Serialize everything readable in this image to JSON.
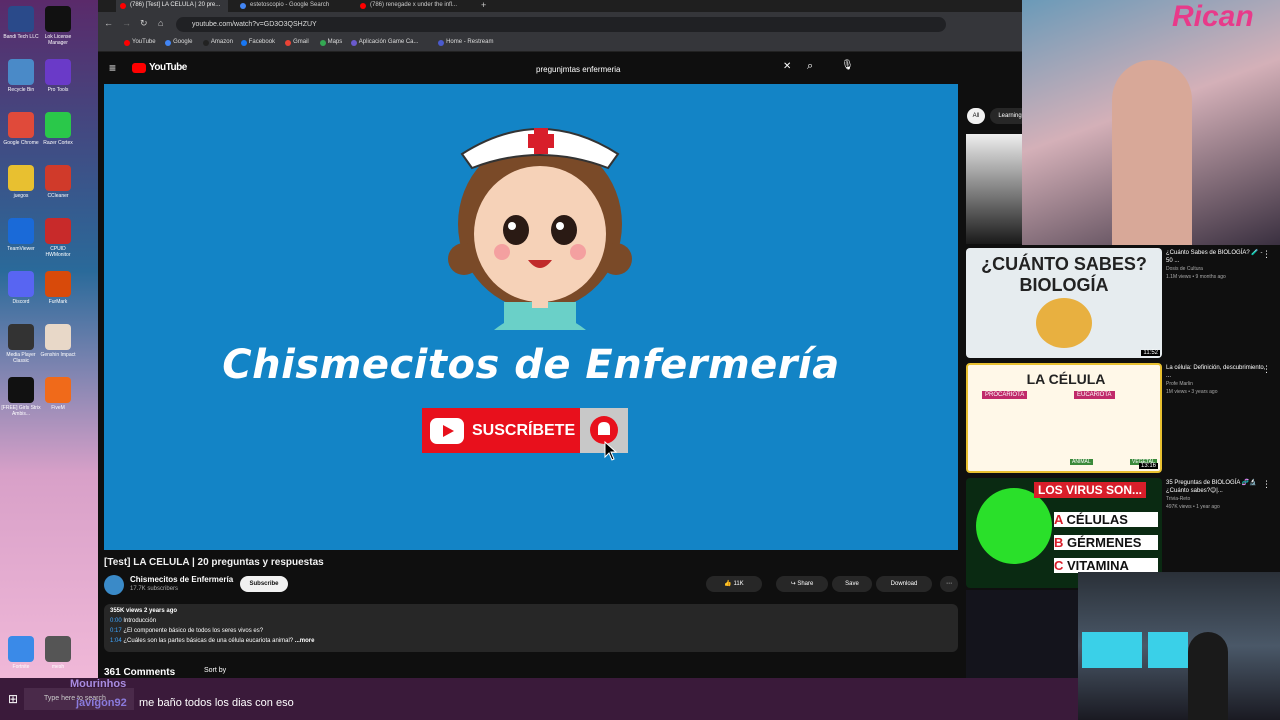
{
  "desktop": {
    "icons": [
      {
        "label": "Bandi Tech LLC",
        "color": "#2a4a8a"
      },
      {
        "label": "Lok License Manager",
        "color": "#111"
      },
      {
        "label": "Recycle Bin",
        "color": "#4a8ac8"
      },
      {
        "label": "Pro Tools",
        "color": "#6a3ac8"
      },
      {
        "label": "Google Chrome",
        "color": "#e04a3a"
      },
      {
        "label": "Razer Cortex",
        "color": "#2ac84a"
      },
      {
        "label": "juegos",
        "color": "#e8c030"
      },
      {
        "label": "CCleaner",
        "color": "#d03a2a"
      },
      {
        "label": "TeamViewer",
        "color": "#1a6ad8"
      },
      {
        "label": "CPUID HWMonitor",
        "color": "#c82a2a"
      },
      {
        "label": "Discord",
        "color": "#5865f2"
      },
      {
        "label": "FurMark",
        "color": "#d84a0a"
      },
      {
        "label": "Media Player Classic",
        "color": "#333"
      },
      {
        "label": "Genshin Impact",
        "color": "#e8d8c8"
      },
      {
        "label": "[FREE] Girls Strix Ambis...",
        "color": "#111"
      },
      {
        "label": "FiveM",
        "color": "#f06a1a"
      },
      {
        "label": "Fortnite",
        "color": "#3a8ae8"
      },
      {
        "label": "mesh",
        "color": "#555"
      }
    ]
  },
  "browser": {
    "tabs": [
      {
        "label": "(786) [Test] LA CELULA | 20 pre...",
        "active": true
      },
      {
        "label": "estetoscopio - Google Search",
        "active": false
      },
      {
        "label": "(786) renegade x under the infl...",
        "active": false
      }
    ],
    "url": "youtube.com/watch?v=GD3O3QSHZUY",
    "bookmarks": [
      "YouTube",
      "Google",
      "Amazon",
      "Facebook",
      "Gmail",
      "Maps",
      "Aplicación Game Ca...",
      "Home - Restream"
    ]
  },
  "youtube": {
    "search_query": "pregunjmtas enfermeria",
    "video_thumb_title": "Chismecitos de Enfermería",
    "subscribe_graphic_label": "SUSCRÍBETE",
    "video_title": "[Test] LA CELULA | 20 preguntas y respuestas",
    "channel_name": "Chismecitos de Enfermería",
    "channel_subs": "17.7K subscribers",
    "subscribe_label": "Subscribe",
    "likes": "11K",
    "share_label": "Share",
    "save_label": "Save",
    "download_label": "Download",
    "views_line": "355K views  2 years ago",
    "desc_lines": [
      {
        "time": "0:00",
        "text": "Introducción"
      },
      {
        "time": "0:17",
        "text": "¿El componente básico de todos los seres vivos es?"
      },
      {
        "time": "1:04",
        "text": "¿Cuáles son las partes básicas de una célula eucariota animal?"
      }
    ],
    "more_label": "...more",
    "comments_count": "361 Comments",
    "sort_label": "Sort by",
    "chips": [
      "All",
      "Learning"
    ],
    "recommendations": [
      {
        "thumb_title": "¿CUÁNTO SABES? BIOLOGÍA",
        "title": "¿Cuánto Sabes de BIOLOGÍA? 🧪 - 50 ...",
        "channel": "Dosis de Cultura",
        "meta": "1.1M views • 9 months ago",
        "duration": "11:52"
      },
      {
        "thumb_title": "LA CÉLULA",
        "title": "La célula: Definición, descubrimiento, ...",
        "channel": "Profe Marlin",
        "meta": "1M views • 3 years ago",
        "duration": "13:16"
      },
      {
        "thumb_title": "LOS VIRUS SON...",
        "title": "35 Preguntas de BIOLOGÍA 🧬🔬¿Cuánto sabes?😊|...",
        "channel": "Trivia-Reto",
        "meta": "497K views • 1 year ago",
        "duration": ""
      }
    ],
    "thumb2_labels": [
      "PROCARIOTA",
      "EUCARIOTA",
      "ANIMAL",
      "VEGETAL"
    ],
    "thumb3_options": [
      {
        "letter": "A",
        "text": "CÉLULAS"
      },
      {
        "letter": "B",
        "text": "GÉRMENES"
      },
      {
        "letter": "C",
        "text": "VITAMINA"
      }
    ]
  },
  "webcam": {
    "sign_text": "Rican"
  },
  "taskbar": {
    "search_placeholder": "Type here to search"
  },
  "chat": {
    "user1": "Mourinhos",
    "user2": "javigon92",
    "message": "me baño todos los dias con eso"
  }
}
